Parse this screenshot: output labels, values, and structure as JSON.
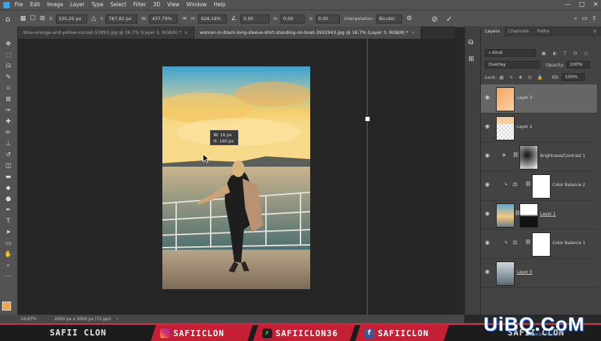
{
  "menu": {
    "items": [
      "File",
      "Edit",
      "Image",
      "Layer",
      "Type",
      "Select",
      "Filter",
      "3D",
      "View",
      "Window",
      "Help"
    ]
  },
  "window_controls": [
    "—",
    "□",
    "✕"
  ],
  "options": {
    "x_label": "X:",
    "x_value": "335.20 px",
    "y_label": "Y:",
    "y_value": "787.82 px",
    "w_label": "W:",
    "w_value": "437.79%",
    "h_label": "H:",
    "h_value": "628.19%",
    "angle_value": "0.00",
    "hskew_label": "H:",
    "hskew_value": "0.00",
    "vskew_label": "V:",
    "vskew_value": "0.00",
    "interp_label": "Interpolation:",
    "interp_value": "Bicubic"
  },
  "tabs": [
    {
      "label": "blue-orange-and-yellow-sunset-53893.jpg @ 16.7% (Layer 3, RGB/8) *"
    },
    {
      "label": "woman-in-black-long-sleeve-shirt-standing-on-boat-3922943.jpg @ 16.7% (Layer 3, RGB/8) *"
    }
  ],
  "tooltip": {
    "w": "W:  16 px",
    "h": "H:  160 px"
  },
  "layers_panel": {
    "tabs": [
      "Layers",
      "Channels",
      "Paths"
    ],
    "kind_label": "Kind",
    "blend_mode": "Overlay",
    "opacity_label": "Opacity:",
    "opacity_value": "100%",
    "lock_label": "Lock:",
    "fill_label": "Fill:",
    "fill_value": "100%",
    "layers": [
      {
        "name": "Layer 3"
      },
      {
        "name": "Layer 2"
      },
      {
        "name": "Brightness/Contrast 1"
      },
      {
        "name": "Color Balance 2"
      },
      {
        "name": "Layer 1"
      },
      {
        "name": "Color Balance 1"
      },
      {
        "name": "Layer 0"
      }
    ]
  },
  "status": {
    "zoom": "16.67%",
    "doc": "2000 px x 3000 px (72 ppi)"
  },
  "footer": {
    "name": "SAFII CLON",
    "instagram": "SAFIICLON",
    "tiktok": "SAFIICLON36",
    "facebook": "SAFIICLON",
    "watermark": "UiBQ.CoM",
    "watermark_sub": "www.psahz.com",
    "name_right": "SAFII CLON"
  },
  "colors": {
    "accent": "#31a8ff",
    "guide": "#2a6cd6",
    "footer_red": "#c41f35"
  }
}
